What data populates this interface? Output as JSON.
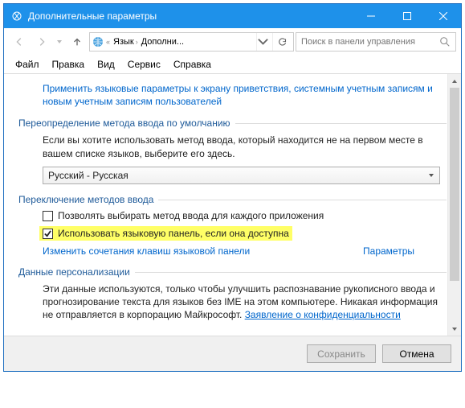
{
  "title": "Дополнительные параметры",
  "breadcrumb": {
    "root_icon": "control-panel",
    "seg1": "Язык",
    "seg2": "Дополни..."
  },
  "search": {
    "placeholder": "Поиск в панели управления"
  },
  "menu": {
    "file": "Файл",
    "edit": "Правка",
    "view": "Вид",
    "tools": "Сервис",
    "help": "Справка"
  },
  "topLink": "Применить языковые параметры к экрану приветствия, системным учетным записям и новым учетным записям пользователей",
  "section1": {
    "title": "Переопределение метода ввода по умолчанию",
    "body": "Если вы хотите использовать метод ввода, который находится не на первом месте в вашем списке языков, выберите его здесь.",
    "select": "Русский - Русская"
  },
  "section2": {
    "title": "Переключение методов ввода",
    "cb1": {
      "label": "Позволять выбирать метод ввода для каждого приложения",
      "checked": false
    },
    "cb2": {
      "label": "Использовать языковую панель, если она доступна",
      "checked": true
    },
    "params": "Параметры",
    "link": "Изменить сочетания клавиш языковой панели"
  },
  "section3": {
    "title": "Данные персонализации",
    "body": "Эти данные используются, только чтобы улучшить распознавание рукописного ввода и прогнозирование текста для языков без IME на этом компьютере. Никакая информация не отправляется в корпорацию Майкрософт. ",
    "privacy": "Заявление о конфиденциальности"
  },
  "buttons": {
    "save": "Сохранить",
    "cancel": "Отмена"
  }
}
